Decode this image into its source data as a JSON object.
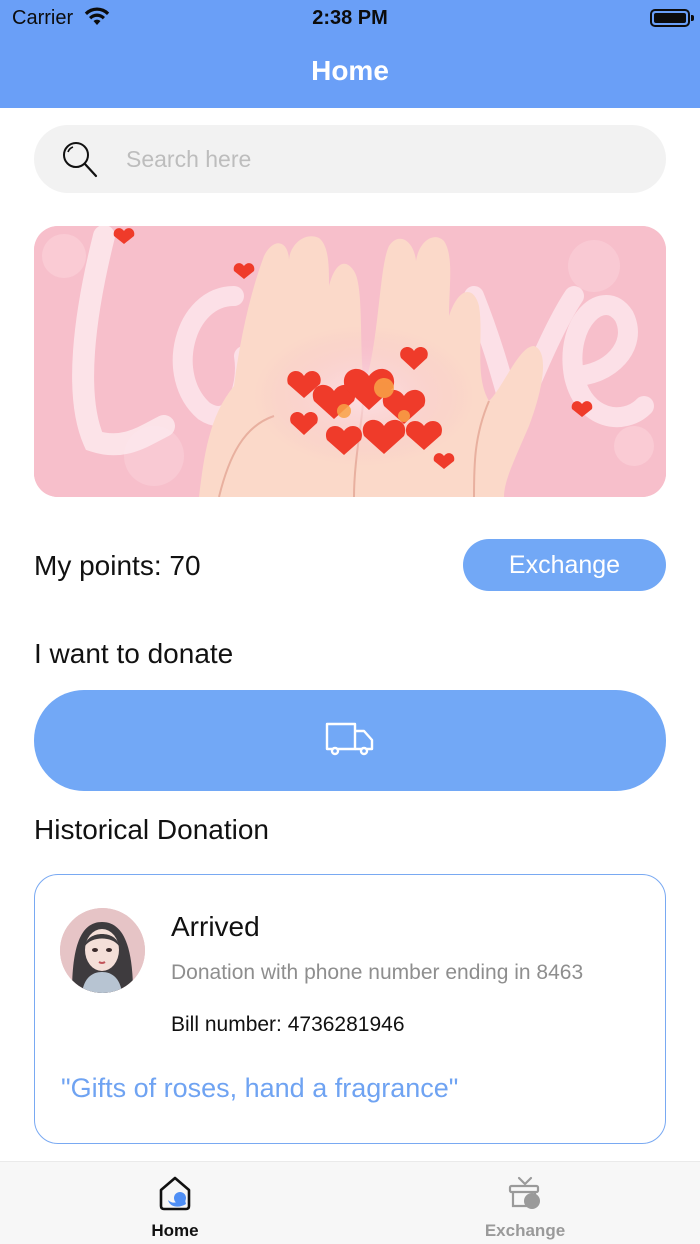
{
  "status_bar": {
    "carrier": "Carrier",
    "time": "2:38 PM"
  },
  "nav": {
    "title": "Home"
  },
  "search": {
    "placeholder": "Search here",
    "value": ""
  },
  "points": {
    "label": "My points: 70",
    "exchange_label": "Exchange"
  },
  "donate": {
    "label": "I want to donate"
  },
  "history": {
    "label": "Historical Donation",
    "items": [
      {
        "status": "Arrived",
        "description": "Donation with phone number ending in 8463",
        "bill": "Bill number: 4736281946",
        "quote": "\"Gifts of roses, hand a fragrance\""
      }
    ]
  },
  "tabbar": {
    "tabs": [
      {
        "label": "Home",
        "icon": "home-icon",
        "active": true
      },
      {
        "label": "Exchange",
        "icon": "gift-icon",
        "active": false
      }
    ]
  },
  "colors": {
    "primary": "#6a9ff7",
    "button": "#72a8f6",
    "quote": "#6fa3f2",
    "card_border": "#79a9f2"
  }
}
